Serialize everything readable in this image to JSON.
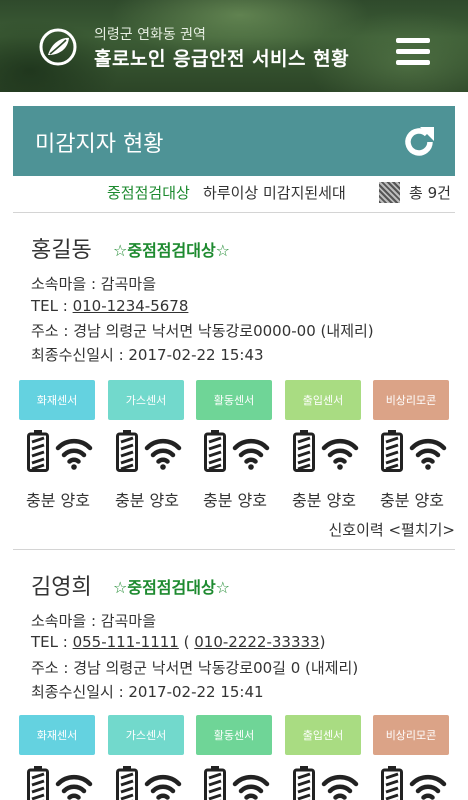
{
  "header": {
    "subtitle": "의령군 연화동 권역",
    "title": "홀로노인 응급안전 서비스 현황"
  },
  "panel": {
    "title": "미감지자 현황"
  },
  "summary": {
    "priority": "중점점검대상",
    "description": "하루이상 미감지된세대",
    "total": "총 9건"
  },
  "sensor_labels": [
    "화재센서",
    "가스센서",
    "활동센서",
    "출입센서",
    "비상리모콘"
  ],
  "status_labels": [
    "충분 양호",
    "충분 양호",
    "충분 양호",
    "충분 양호",
    "충분 양호"
  ],
  "colors": {
    "header_bg": "#2f4a2c",
    "panel_bg": "#4e9396",
    "priority_green": "#1d8a2f",
    "sensor_fire": "#64d2e0",
    "sensor_gas": "#72d9cc",
    "sensor_activity": "#6fd597",
    "sensor_door": "#a9dc82",
    "sensor_sos": "#dba387"
  },
  "icons": {
    "logo": "leaf-logo-icon",
    "menu": "hamburger-menu-icon",
    "refresh": "refresh-icon",
    "battery": "battery-icon",
    "signal": "wifi-signal-icon"
  },
  "residents": [
    {
      "name": "홍길동",
      "tag": "☆중점점검대상☆",
      "village": "소속마을 : 감곡마을",
      "tel_label": "TEL : ",
      "tel1": "010-1234-5678",
      "address": "주소 : 경남 의령군 낙서면 낙동강로0000-00 (내제리)",
      "last_received": "최종수신일시 : 2017-02-22 15:43",
      "history_label": "신호이력 <펼치기>"
    },
    {
      "name": "김영희",
      "tag": "☆중점점검대상☆",
      "village": "소속마을 : 감곡마을",
      "tel_label": "TEL : ",
      "tel1": "055-111-1111",
      "tel_open": " ( ",
      "tel2": "010-2222-33333",
      "tel_close": ")",
      "address": "주소 : 경남 의령군 낙서면 낙동강로00길  0 (내제리)",
      "last_received": "최종수신일시 : 2017-02-22 15:41"
    }
  ]
}
